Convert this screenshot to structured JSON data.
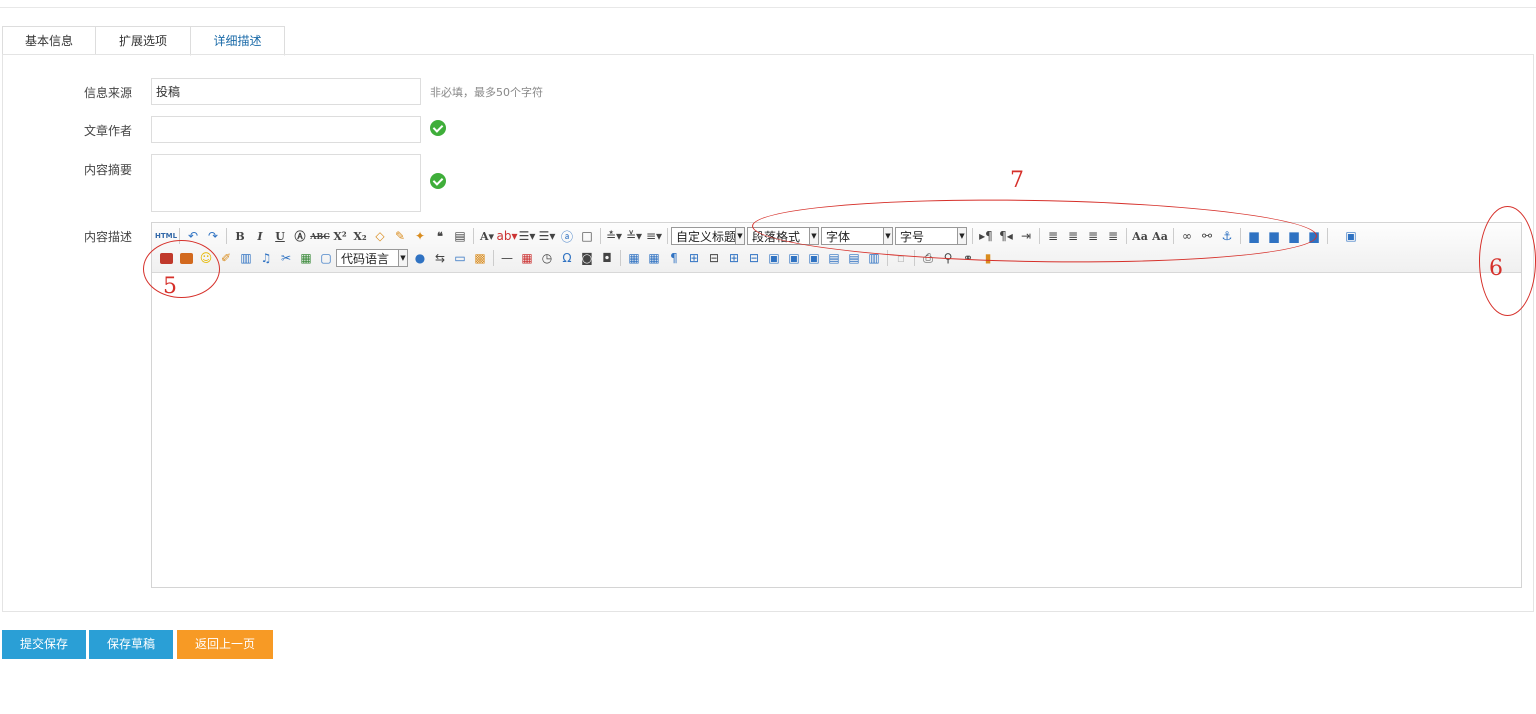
{
  "tabs": [
    "基本信息",
    "扩展选项",
    "详细描述"
  ],
  "fields": {
    "source_label": "信息来源",
    "source_value": "投稿",
    "source_hint": "非必填，最多50个字符",
    "author_label": "文章作者",
    "author_value": "",
    "summary_label": "内容摘要",
    "summary_value": "",
    "content_label": "内容描述"
  },
  "toolbar": {
    "source_btn": "HTML",
    "custom_heading": "自定义标题",
    "paragraph": "段落格式",
    "font_family": "字体",
    "font_size": "字号",
    "code_language": "代码语言"
  },
  "annotations": [
    "5",
    "6",
    "7"
  ],
  "buttons": {
    "submit": "提交保存",
    "draft": "保存草稿",
    "back": "返回上一页"
  },
  "colors": {
    "primary": "#2a9fd6",
    "warning": "#f79a25",
    "annotation": "#d6302a",
    "success": "#3fae3a"
  }
}
